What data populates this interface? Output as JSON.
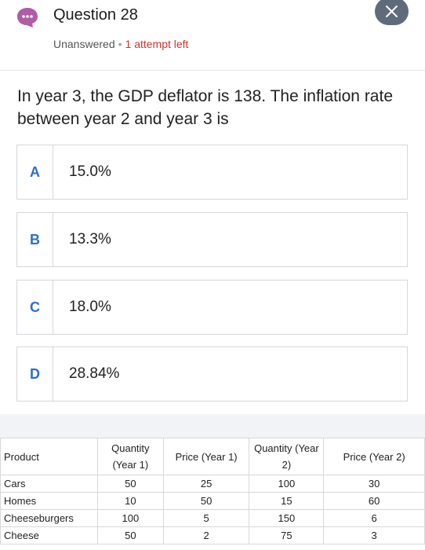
{
  "header": {
    "title": "Question 28",
    "status": "Unanswered",
    "attempts": "1 attempt left"
  },
  "question": {
    "text": "In year 3, the GDP deflator is 138. The inflation rate between year 2 and year 3 is"
  },
  "options": [
    {
      "letter": "A",
      "text": "15.0%"
    },
    {
      "letter": "B",
      "text": "13.3%"
    },
    {
      "letter": "C",
      "text": "18.0%"
    },
    {
      "letter": "D",
      "text": "28.84%"
    }
  ],
  "table": {
    "headers": [
      "Product",
      "Quantity (Year 1)",
      "Price (Year 1)",
      "Quantity (Year 2)",
      "Price (Year 2)"
    ],
    "rows": [
      [
        "Cars",
        "50",
        "25",
        "100",
        "30"
      ],
      [
        "Homes",
        "10",
        "50",
        "15",
        "60"
      ],
      [
        "Cheeseburgers",
        "100",
        "5",
        "150",
        "6"
      ],
      [
        "Cheese",
        "50",
        "2",
        "75",
        "3"
      ]
    ]
  },
  "colors": {
    "accent": "#2d6fd0",
    "chat_icon": "#b05ca6",
    "attempts": "#d0342c",
    "close_button": "#5f6b7a"
  },
  "icons": {
    "chat": "chat-bubble-icon",
    "close": "close-icon"
  }
}
